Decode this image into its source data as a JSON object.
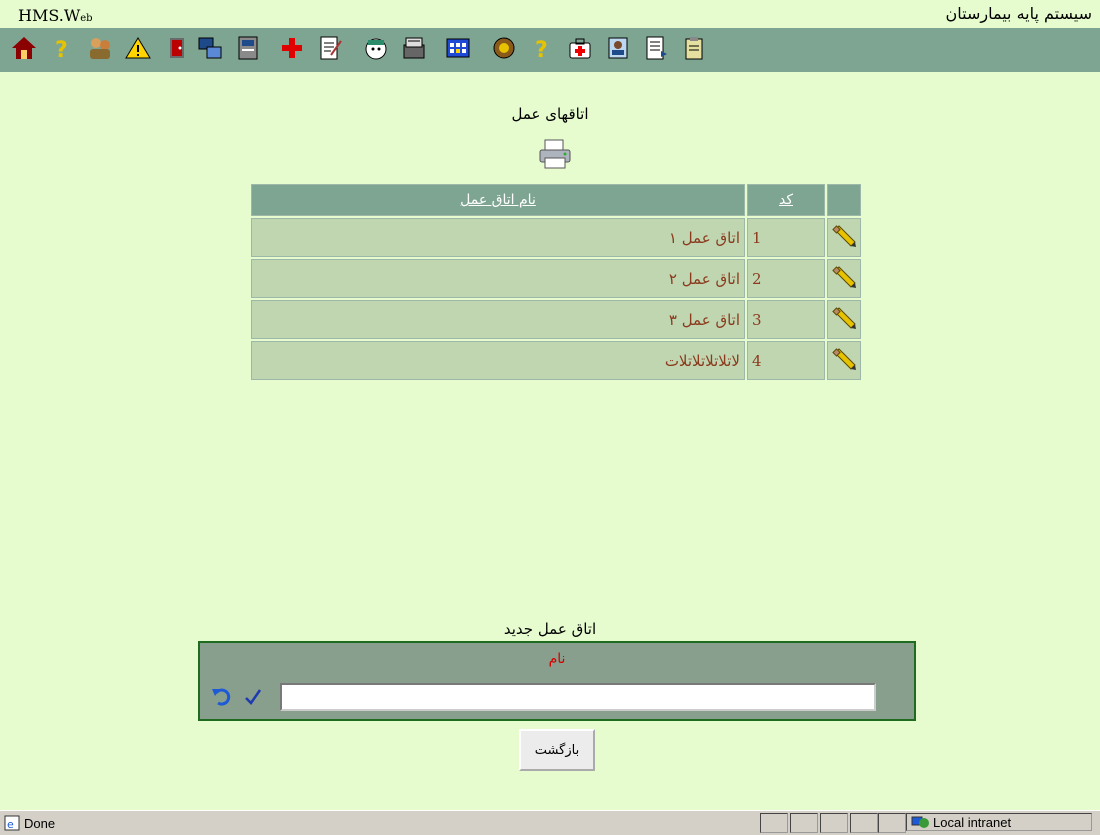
{
  "header": {
    "brand_main": "HMS.W",
    "brand_small": "eb",
    "app_title": "سیستم پایه بیمارستان"
  },
  "toolbar": {
    "icons": [
      "home-icon",
      "help-icon",
      "users-icon",
      "warning-icon",
      "exit-icon",
      "transfer-icon",
      "server-icon",
      "red-cross-icon",
      "form-edit-icon",
      "nurse-icon",
      "archive-icon",
      "grid-icon",
      "bio-icon",
      "help-icon-2",
      "first-aid-icon",
      "patient-report-icon",
      "document-icon",
      "clipboard-icon"
    ]
  },
  "page": {
    "heading": "اتاقهای عمل",
    "table": {
      "headers": {
        "name": "نام اتاق عمل",
        "code": "کد"
      },
      "rows": [
        {
          "code": "1",
          "name": "اتاق عمل ۱"
        },
        {
          "code": "2",
          "name": "اتاق عمل ۲"
        },
        {
          "code": "3",
          "name": "اتاق عمل ۳"
        },
        {
          "code": "4",
          "name": "لاتلاتلاتلاتلات"
        }
      ]
    }
  },
  "new_form": {
    "title": "اتاق عمل جدید",
    "field_label": "نام",
    "field_value": "",
    "back_label": "بازگشت"
  },
  "status": {
    "left_text": "Done",
    "zone_text": "Local intranet"
  },
  "colors": {
    "background": "#e6fccf",
    "toolbar": "#7ea492",
    "row": "#bfd6b1",
    "row_text": "#8b3a1d",
    "label_red": "#d40000"
  }
}
